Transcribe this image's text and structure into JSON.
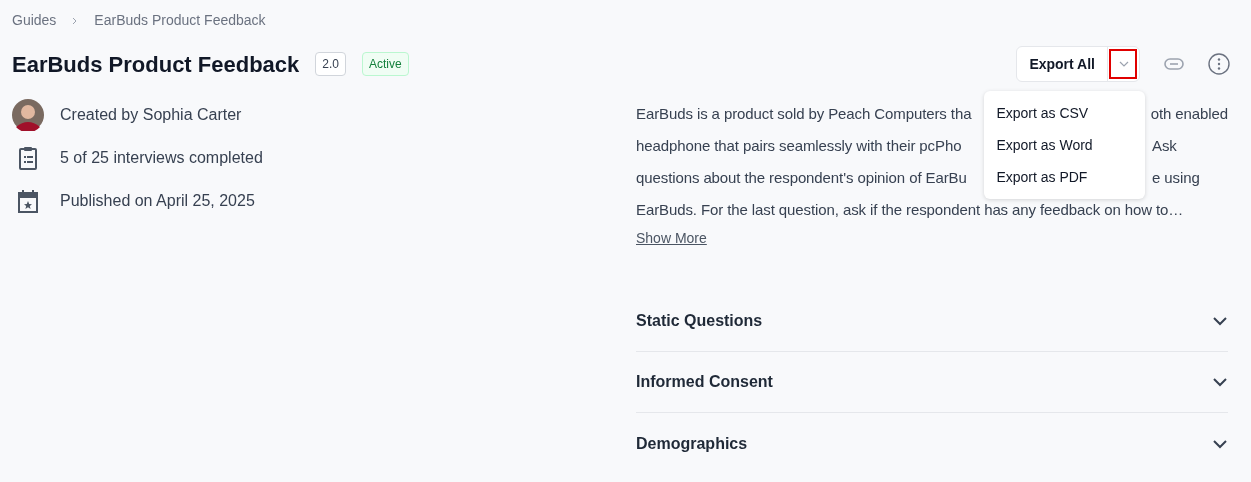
{
  "breadcrumb": [
    "Guides",
    "EarBuds Product Feedback"
  ],
  "header": {
    "title": "EarBuds Product Feedback",
    "version": "2.0",
    "status": "Active"
  },
  "actions": {
    "export_button": "Export All",
    "dropdown_toggle": {
      "expanded": true,
      "highlighted": true
    },
    "menu": [
      "Export as CSV",
      "Export as Word",
      "Export as PDF"
    ]
  },
  "meta": [
    {
      "kind": "avatar",
      "text": "Created by Sophia Carter"
    },
    {
      "kind": "clipboard",
      "text": "5 of 25 interviews completed"
    },
    {
      "kind": "calendar",
      "text": "Published on April 25, 2025"
    }
  ],
  "description": {
    "lines": [
      {
        "before": "EarBuds is a product sold by Peach Computers tha",
        "after": "oth enabled"
      },
      {
        "before": "headphone that pairs seamlessly with their pcPho",
        "after": "Ask"
      },
      {
        "before": "questions about the respondent's opinion of EarBu",
        "after": "e using"
      },
      {
        "before": "EarBuds. For the last question, ask if the respondent has any feedback on how to…"
      }
    ],
    "link": "Show More"
  },
  "sections": [
    {
      "title": "Static Questions",
      "expanded": false
    },
    {
      "title": "Informed Consent",
      "expanded": false
    },
    {
      "title": "Demographics",
      "expanded": false
    }
  ]
}
